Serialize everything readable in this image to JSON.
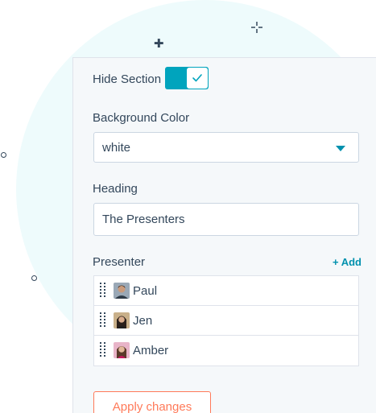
{
  "colors": {
    "accent": "#00a4bd",
    "link": "#0091ae",
    "primary_button": "#ff7a59",
    "text": "#33475b",
    "panel_bg": "#f5f8fa",
    "border": "#cbd6e2"
  },
  "hide_section": {
    "label": "Hide Section",
    "enabled": true
  },
  "background_color": {
    "label": "Background Color",
    "value": "white"
  },
  "heading": {
    "label": "Heading",
    "value": "The Presenters"
  },
  "presenter": {
    "label": "Presenter",
    "add_label": "+ Add",
    "items": [
      {
        "name": "Paul",
        "avatar": "avatar-paul"
      },
      {
        "name": "Jen",
        "avatar": "avatar-jen"
      },
      {
        "name": "Amber",
        "avatar": "avatar-amber"
      }
    ]
  },
  "actions": {
    "apply_label": "Apply changes"
  },
  "icons": [
    "plus-icon",
    "sparkle-icon",
    "check-icon",
    "chevron-down-icon",
    "drag-handle-icon"
  ]
}
